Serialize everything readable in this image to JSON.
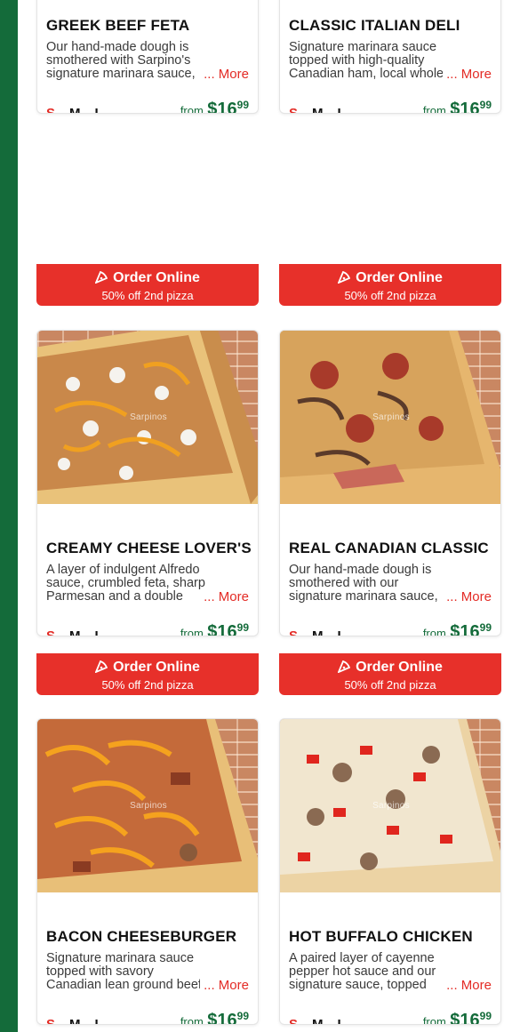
{
  "order": {
    "label": "Order Online",
    "promo": "50% off 2nd pizza"
  },
  "more_label": "... More",
  "watermark": "Sarpinos",
  "price": {
    "from": "from",
    "dollars": "$16",
    "cents": "99"
  },
  "sizes": [
    "S",
    "M",
    "L"
  ],
  "colors": {
    "brand_green": "#146b3a",
    "accent_red": "#e7302a"
  },
  "pizzas": [
    {
      "name": "GREEK BEEF FETA",
      "description": "Our hand-made dough is smothered with Sarpino's signature marinara sauce, topped with"
    },
    {
      "name": "CLASSIC ITALIAN DELI",
      "description": "Signature marinara sauce topped with high-quality Canadian ham, local whole-milk"
    },
    {
      "name": "CREAMY CHEESE LOVER'S",
      "description": "A layer of indulgent Alfredo sauce, crumbled feta, sharp Parmesan and a double layer of"
    },
    {
      "name": "REAL CANADIAN CLASSIC",
      "description": "Our hand-made dough is smothered with our signature marinara sauce, topped with premium"
    },
    {
      "name": "BACON CHEESEBURGER",
      "description": "Signature marinara sauce topped with savory Canadian lean ground beef, crispy bacon"
    },
    {
      "name": "HOT BUFFALO CHICKEN",
      "description": "A paired layer of cayenne pepper hot sauce and our signature sauce, topped with"
    }
  ]
}
